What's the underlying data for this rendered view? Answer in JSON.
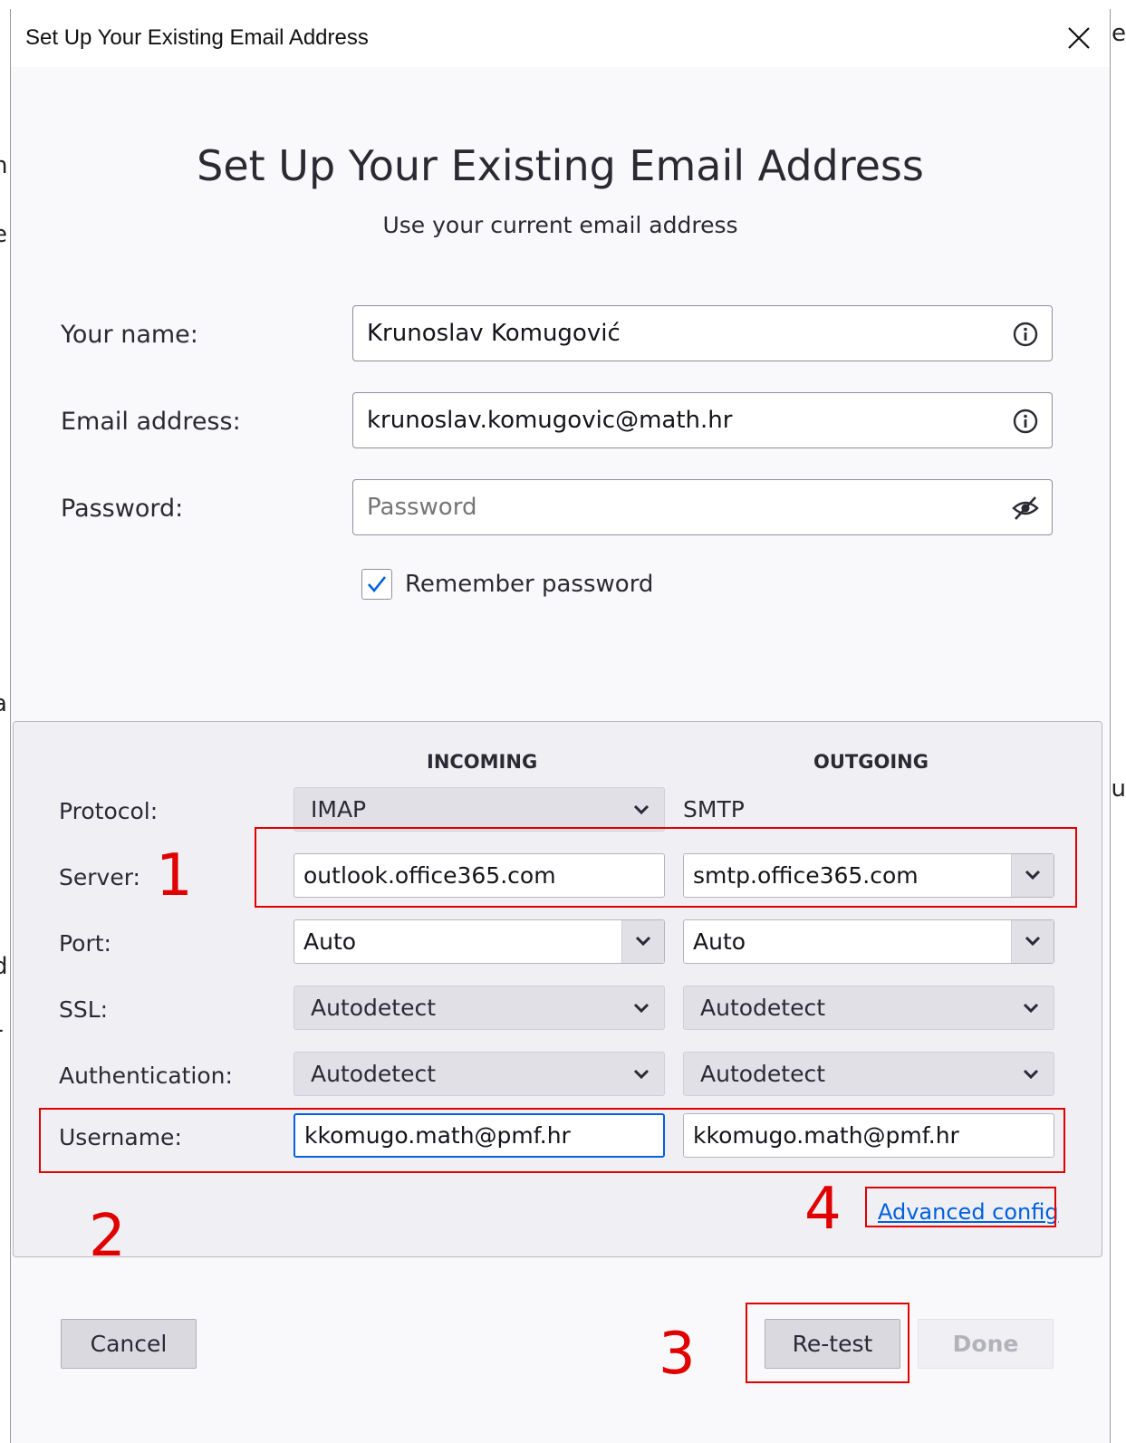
{
  "window": {
    "title": "Set Up Your Existing Email Address"
  },
  "header": {
    "title": "Set Up Your Existing Email Address",
    "subtitle": "Use your current email address"
  },
  "form": {
    "name_label": "Your name:",
    "name_value": "Krunoslav Komugović",
    "email_label": "Email address:",
    "email_value": "krunoslav.komugovic@math.hr",
    "password_label": "Password:",
    "password_placeholder": "Password",
    "remember_label": "Remember password",
    "remember_checked": true
  },
  "config": {
    "incoming_header": "INCOMING",
    "outgoing_header": "OUTGOING",
    "protocol_label": "Protocol:",
    "incoming_protocol": "IMAP",
    "outgoing_protocol": "SMTP",
    "server_label": "Server:",
    "incoming_server": "outlook.office365.com",
    "outgoing_server": "smtp.office365.com",
    "port_label": "Port:",
    "incoming_port": "Auto",
    "outgoing_port": "Auto",
    "ssl_label": "SSL:",
    "incoming_ssl": "Autodetect",
    "outgoing_ssl": "Autodetect",
    "auth_label": "Authentication:",
    "incoming_auth": "Autodetect",
    "outgoing_auth": "Autodetect",
    "username_label": "Username:",
    "incoming_username": "kkomugo.math@pmf.hr",
    "outgoing_username": "kkomugo.math@pmf.hr",
    "advanced_link": "Advanced config"
  },
  "buttons": {
    "cancel": "Cancel",
    "retest": "Re-test",
    "done": "Done"
  },
  "annotations": {
    "n1": "1",
    "n2": "2",
    "n3": "3",
    "n4": "4",
    "color": "#e00000"
  },
  "colors": {
    "accent": "#0060df",
    "panel_bg": "#f0f0f4",
    "dialog_bg": "#f9f9fb"
  }
}
